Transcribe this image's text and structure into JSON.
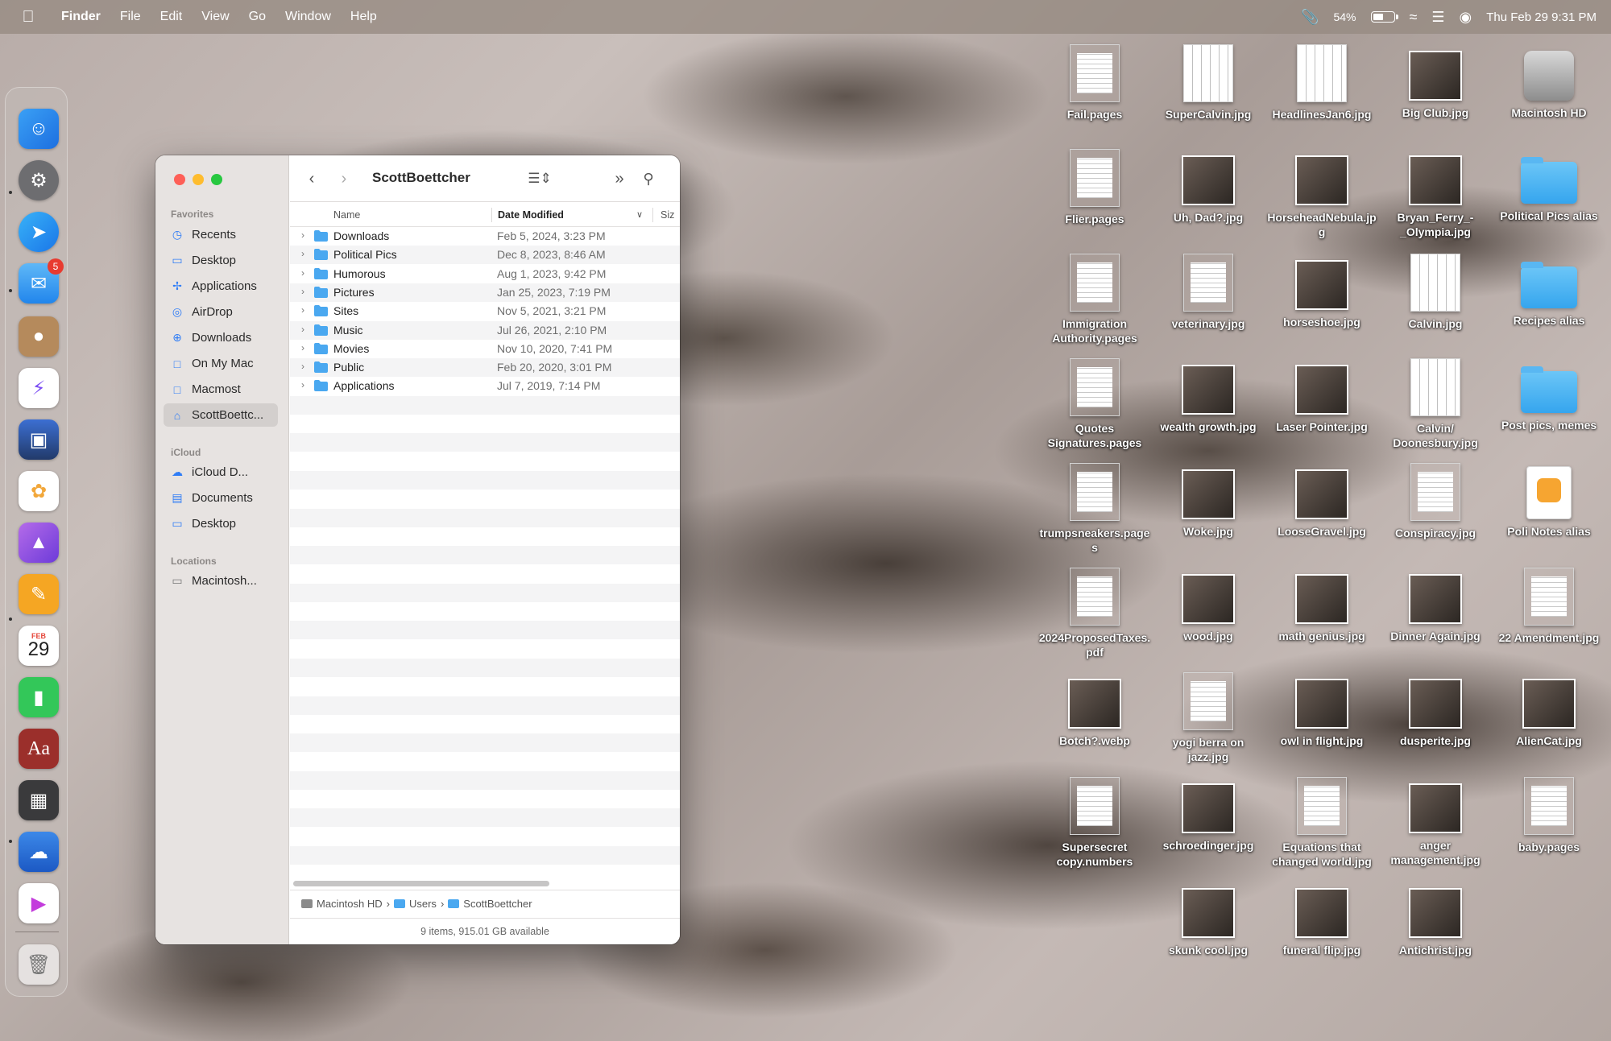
{
  "menubar": {
    "app": "Finder",
    "items": [
      "File",
      "Edit",
      "View",
      "Go",
      "Window",
      "Help"
    ],
    "battery": "54%",
    "battery_level": 0.54,
    "clock": "Thu Feb 29  9:31 PM"
  },
  "dock": {
    "mail_badge": "5",
    "calendar_month": "FEB",
    "calendar_day": "29",
    "dictionary_label": "Aa"
  },
  "finder": {
    "title": "ScottBoettcher",
    "sidebar": {
      "favorites_header": "Favorites",
      "favorites": [
        {
          "label": "Recents",
          "icon": "clock-icon"
        },
        {
          "label": "Desktop",
          "icon": "desktop-icon"
        },
        {
          "label": "Applications",
          "icon": "applications-icon"
        },
        {
          "label": "AirDrop",
          "icon": "airdrop-icon"
        },
        {
          "label": "Downloads",
          "icon": "download-icon"
        },
        {
          "label": "On My Mac",
          "icon": "folder-icon"
        },
        {
          "label": "Macmost",
          "icon": "folder-icon"
        },
        {
          "label": "ScottBoettc...",
          "icon": "home-icon"
        }
      ],
      "icloud_header": "iCloud",
      "icloud": [
        {
          "label": "iCloud D...",
          "icon": "cloud-icon"
        },
        {
          "label": "Documents",
          "icon": "document-icon"
        },
        {
          "label": "Desktop",
          "icon": "desktop-icon"
        }
      ],
      "locations_header": "Locations",
      "locations": [
        {
          "label": "Macintosh...",
          "icon": "disk-icon"
        }
      ]
    },
    "columns": {
      "name": "Name",
      "date": "Date Modified",
      "size": "Siz"
    },
    "rows": [
      {
        "name": "Downloads",
        "date": "Feb 5, 2024, 3:23 PM"
      },
      {
        "name": "Political Pics",
        "date": "Dec 8, 2023, 8:46 AM"
      },
      {
        "name": "Humorous",
        "date": "Aug 1, 2023, 9:42 PM"
      },
      {
        "name": "Pictures",
        "date": "Jan 25, 2023, 7:19 PM"
      },
      {
        "name": "Sites",
        "date": "Nov 5, 2021, 3:21 PM"
      },
      {
        "name": "Music",
        "date": "Jul 26, 2021, 2:10 PM"
      },
      {
        "name": "Movies",
        "date": "Nov 10, 2020, 7:41 PM"
      },
      {
        "name": "Public",
        "date": "Feb 20, 2020, 3:01 PM"
      },
      {
        "name": "Applications",
        "date": "Jul 7, 2019, 7:14 PM"
      }
    ],
    "path": [
      "Macintosh HD",
      "Users",
      "ScottBoettcher"
    ],
    "status": "9 items, 915.01 GB available"
  },
  "desktop": {
    "icons": [
      {
        "label": "Fail.pages",
        "kind": "doc"
      },
      {
        "label": "SuperCalvin.jpg",
        "kind": "comic"
      },
      {
        "label": "HeadlinesJan6.jpg",
        "kind": "comic"
      },
      {
        "label": "Big Club.jpg",
        "kind": "photo"
      },
      {
        "label": "Macintosh HD",
        "kind": "disk"
      },
      {
        "label": "Flier.pages",
        "kind": "doc"
      },
      {
        "label": "Uh, Dad?.jpg",
        "kind": "photo"
      },
      {
        "label": "HorseheadNebula.jpg",
        "kind": "photo"
      },
      {
        "label": "Bryan_Ferry_-_Olympia.jpg",
        "kind": "photo"
      },
      {
        "label": "Political Pics alias",
        "kind": "folder"
      },
      {
        "label": "Immigration Authority.pages",
        "kind": "doc"
      },
      {
        "label": "veterinary.jpg",
        "kind": "doc"
      },
      {
        "label": "horseshoe.jpg",
        "kind": "photo"
      },
      {
        "label": "Calvin.jpg",
        "kind": "comic"
      },
      {
        "label": "Recipes alias",
        "kind": "folder"
      },
      {
        "label": "Quotes Signatures.pages",
        "kind": "doc"
      },
      {
        "label": "wealth growth.jpg",
        "kind": "photo"
      },
      {
        "label": "Laser Pointer.jpg",
        "kind": "photo"
      },
      {
        "label": "Calvin/ Doonesbury.jpg",
        "kind": "comic"
      },
      {
        "label": "Post pics, memes",
        "kind": "folder"
      },
      {
        "label": "trumpsneakers.pages",
        "kind": "doc"
      },
      {
        "label": "Woke.jpg",
        "kind": "photo"
      },
      {
        "label": "LooseGravel.jpg",
        "kind": "photo"
      },
      {
        "label": "Conspiracy.jpg",
        "kind": "doc"
      },
      {
        "label": "Poli Notes alias",
        "kind": "pages"
      },
      {
        "label": "2024ProposedTaxes.pdf",
        "kind": "doc"
      },
      {
        "label": "wood.jpg",
        "kind": "photo"
      },
      {
        "label": "math genius.jpg",
        "kind": "photo"
      },
      {
        "label": "Dinner Again.jpg",
        "kind": "photo"
      },
      {
        "label": "22 Amendment.jpg",
        "kind": "doc"
      },
      {
        "label": "Botch?.webp",
        "kind": "photo"
      },
      {
        "label": "yogi berra on jazz.jpg",
        "kind": "doc"
      },
      {
        "label": "owl in flight.jpg",
        "kind": "photo"
      },
      {
        "label": "dusperite.jpg",
        "kind": "photo"
      },
      {
        "label": "AlienCat.jpg",
        "kind": "photo"
      },
      {
        "label": "Supersecret copy.numbers",
        "kind": "doc"
      },
      {
        "label": "schroedinger.jpg",
        "kind": "photo"
      },
      {
        "label": "Equations that changed world.jpg",
        "kind": "doc"
      },
      {
        "label": "anger management.jpg",
        "kind": "photo"
      },
      {
        "label": "baby.pages",
        "kind": "doc"
      },
      {
        "label": "skunk cool.jpg",
        "kind": "photo"
      },
      {
        "label": "funeral flip.jpg",
        "kind": "photo"
      },
      {
        "label": "Antichrist.jpg",
        "kind": "photo"
      }
    ]
  }
}
